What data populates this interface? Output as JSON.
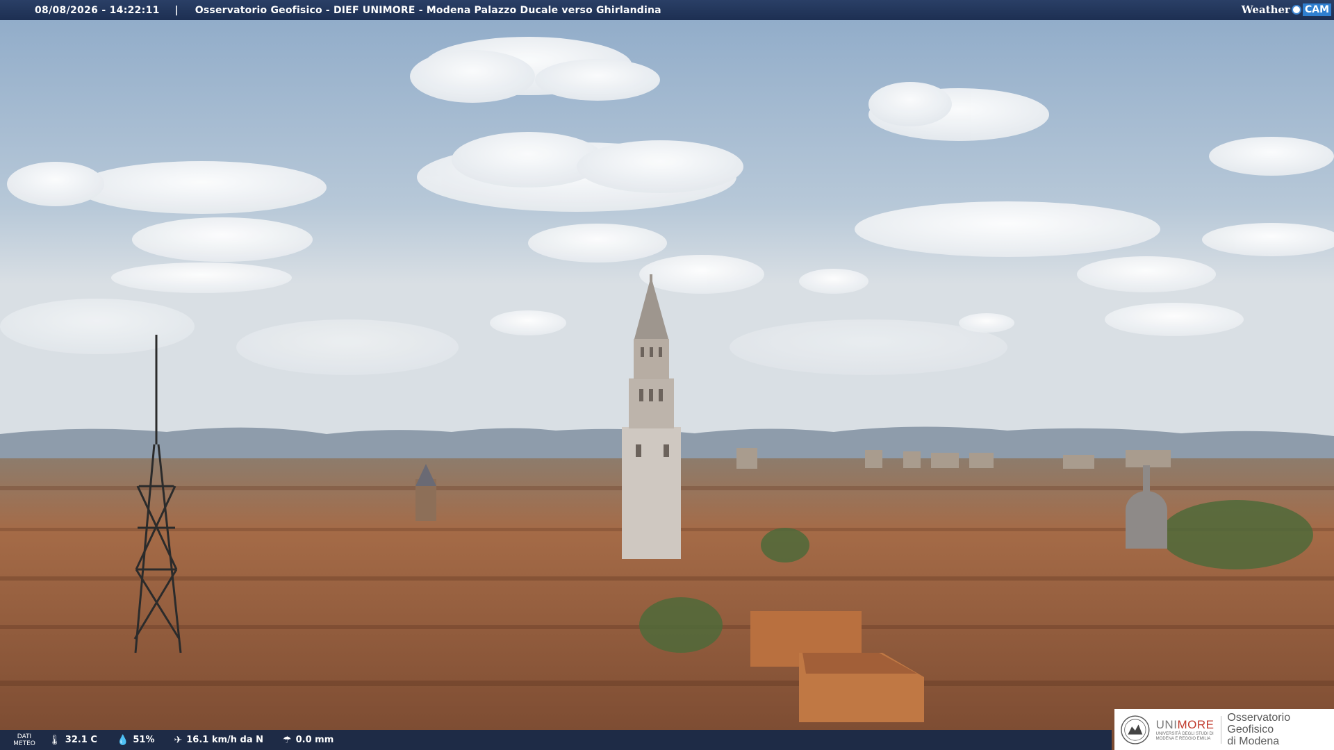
{
  "header": {
    "timestamp": "08/08/2026 - 14:22:11",
    "separator": "|",
    "title": "Osservatorio Geofisico - DIEF UNIMORE - Modena Palazzo Ducale verso Ghirlandina",
    "logo_weather": "Weather",
    "logo_cam": "CAM"
  },
  "meteo": {
    "label_line1": "DATI",
    "label_line2": "METEO",
    "temperature": "32.1 C",
    "humidity": "51%",
    "wind": "16.1 km/h da N",
    "rain": "0.0 mm"
  },
  "branding": {
    "unimore_prefix": "UNI",
    "unimore_highlight": "MORE",
    "unimore_sub_line1": "UNIVERSITÀ DEGLI STUDI DI",
    "unimore_sub_line2": "MODENA E REGGIO EMILIA",
    "observatory_line1": "Osservatorio Geofisico",
    "observatory_line2": "di Modena"
  },
  "colors": {
    "sky_top": "#9fb9d6",
    "sky_bottom": "#d5dde4",
    "roofs": "#a4643e",
    "bars": "#1d2f52"
  }
}
